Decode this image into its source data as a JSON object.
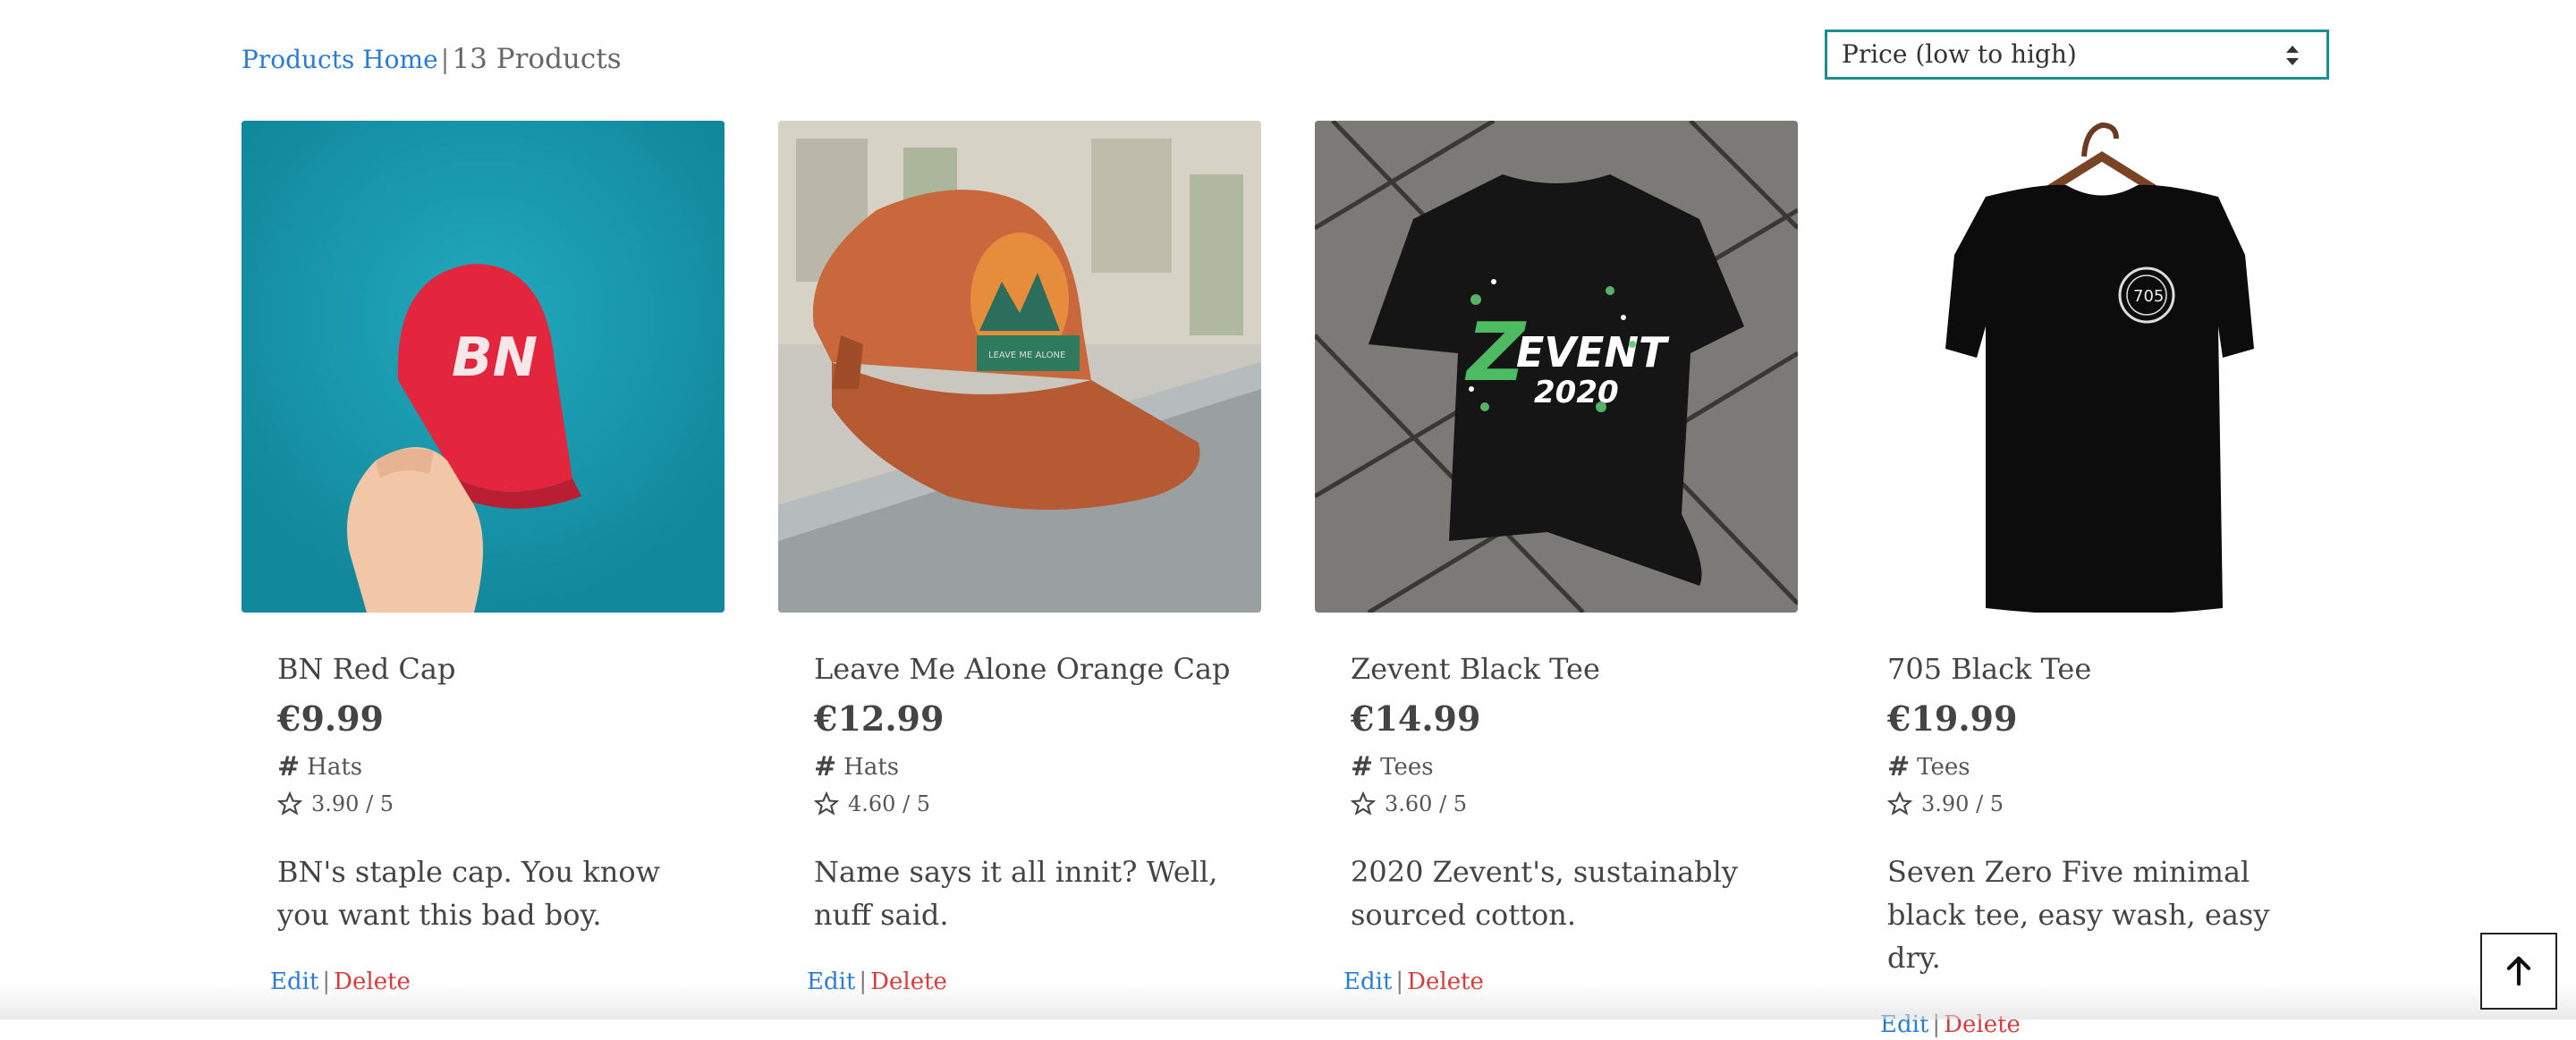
{
  "header": {
    "home_link": "Products Home",
    "separator": "|",
    "count_text": "13 Products"
  },
  "sort": {
    "selected": "Price (low to high)"
  },
  "products": [
    {
      "name": "BN Red Cap",
      "price": "€9.99",
      "category": "Hats",
      "rating": "3.90 / 5",
      "description": "BN's staple cap. You know you want this bad boy.",
      "image_desc": "red cap on teal background",
      "edit": "Edit",
      "delete": "Delete"
    },
    {
      "name": "Leave Me Alone Orange Cap",
      "price": "€12.99",
      "category": "Hats",
      "rating": "4.60 / 5",
      "description": "Name says it all innit? Well, nuff said.",
      "image_desc": "orange cap on concrete ledge",
      "edit": "Edit",
      "delete": "Delete"
    },
    {
      "name": "Zevent Black Tee",
      "price": "€14.99",
      "category": "Tees",
      "rating": "3.60 / 5",
      "description": "2020 Zevent's, sustainably sourced cotton.",
      "image_desc": "black tee on tiled floor",
      "edit": "Edit",
      "delete": "Delete"
    },
    {
      "name": "705 Black Tee",
      "price": "€19.99",
      "category": "Tees",
      "rating": "3.90 / 5",
      "description": "Seven Zero Five minimal black tee, easy wash, easy dry.",
      "image_desc": "black tee on hanger",
      "edit": "Edit",
      "delete": "Delete"
    }
  ],
  "colors": {
    "link": "#2a7bd6",
    "delete": "#d63a3a",
    "sort_border": "#1b8f8f"
  }
}
